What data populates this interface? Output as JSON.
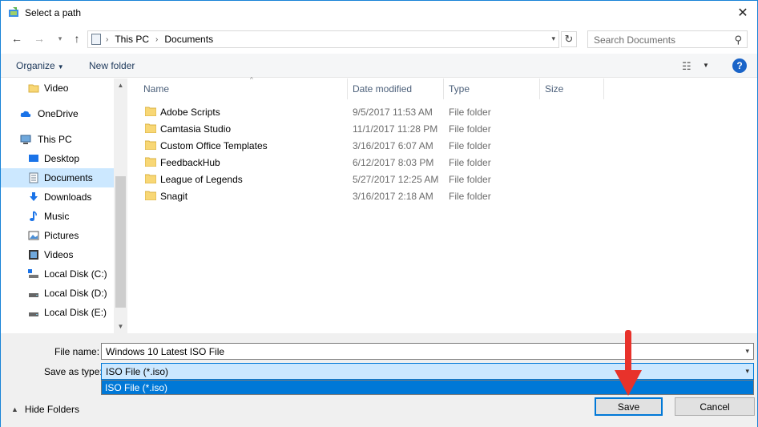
{
  "window": {
    "title": "Select a path"
  },
  "address": {
    "crumbs": [
      "This PC",
      "Documents"
    ],
    "search_placeholder": "Search Documents"
  },
  "toolbar": {
    "organize": "Organize",
    "new_folder": "New folder",
    "help": "?"
  },
  "nav": {
    "items": [
      {
        "label": "Video",
        "icon": "folder-icon"
      },
      {
        "label": "OneDrive",
        "icon": "cloud-icon"
      },
      {
        "label": "This PC",
        "icon": "computer-icon"
      },
      {
        "label": "Desktop",
        "icon": "desktop-icon"
      },
      {
        "label": "Documents",
        "icon": "documents-icon",
        "selected": true
      },
      {
        "label": "Downloads",
        "icon": "download-icon"
      },
      {
        "label": "Music",
        "icon": "music-icon"
      },
      {
        "label": "Pictures",
        "icon": "pictures-icon"
      },
      {
        "label": "Videos",
        "icon": "videos-icon"
      },
      {
        "label": "Local Disk (C:)",
        "icon": "drive-icon"
      },
      {
        "label": "Local Disk (D:)",
        "icon": "drive-icon"
      },
      {
        "label": "Local Disk (E:)",
        "icon": "drive-icon"
      }
    ]
  },
  "files": {
    "columns": [
      "Name",
      "Date modified",
      "Type",
      "Size"
    ],
    "rows": [
      {
        "name": "Adobe Scripts",
        "date": "9/5/2017 11:53 AM",
        "type": "File folder"
      },
      {
        "name": "Camtasia Studio",
        "date": "11/1/2017 11:28 PM",
        "type": "File folder"
      },
      {
        "name": "Custom Office Templates",
        "date": "3/16/2017 6:07 AM",
        "type": "File folder"
      },
      {
        "name": "FeedbackHub",
        "date": "6/12/2017 8:03 PM",
        "type": "File folder"
      },
      {
        "name": "League of Legends",
        "date": "5/27/2017 12:25 AM",
        "type": "File folder"
      },
      {
        "name": "Snagit",
        "date": "3/16/2017 2:18 AM",
        "type": "File folder"
      }
    ]
  },
  "save": {
    "file_name_label": "File name:",
    "file_name_value": "Windows 10 Latest ISO File",
    "save_as_type_label": "Save as type:",
    "save_as_type_value": "ISO File (*.iso)",
    "type_options": [
      "ISO File (*.iso)"
    ],
    "hide_folders": "Hide Folders",
    "save_button": "Save",
    "cancel_button": "Cancel"
  },
  "colors": {
    "accent": "#0078d7",
    "selection": "#cce8ff",
    "folder": "#f8d775",
    "annotation_arrow": "#e8322b"
  }
}
